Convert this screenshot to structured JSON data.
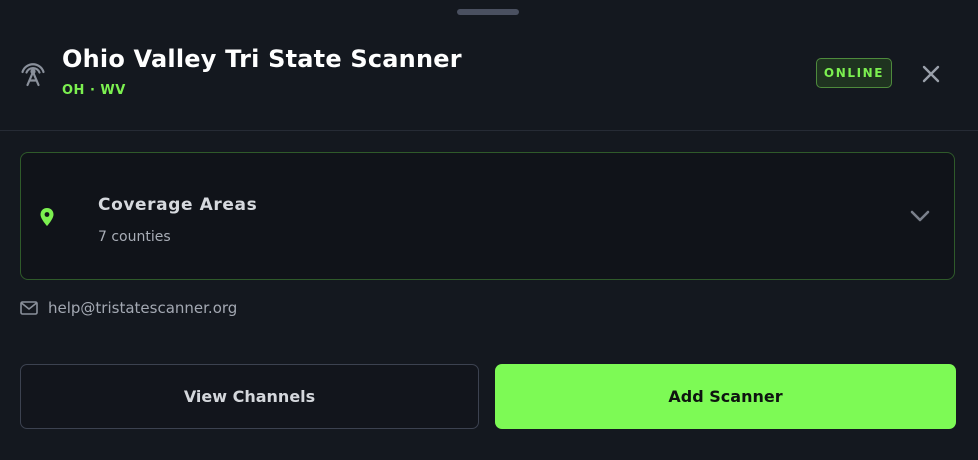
{
  "header": {
    "title": "Ohio Valley Tri State Scanner",
    "subtitle": "OH · WV",
    "status_badge": "ONLINE",
    "icons": {
      "scanner": "radio-tower-icon",
      "close": "close-icon"
    }
  },
  "coverage": {
    "title": "Coverage Areas",
    "subtitle": "7 counties",
    "icons": {
      "pin": "map-pin-icon",
      "expand": "chevron-down-icon"
    }
  },
  "contact": {
    "email": "help@tristatescanner.org",
    "icon": "mail-icon"
  },
  "actions": {
    "secondary_label": "View Channels",
    "primary_label": "Add Scanner"
  },
  "colors": {
    "background": "#14181f",
    "accent": "#7dfa55",
    "status_green": "#7cf050"
  }
}
